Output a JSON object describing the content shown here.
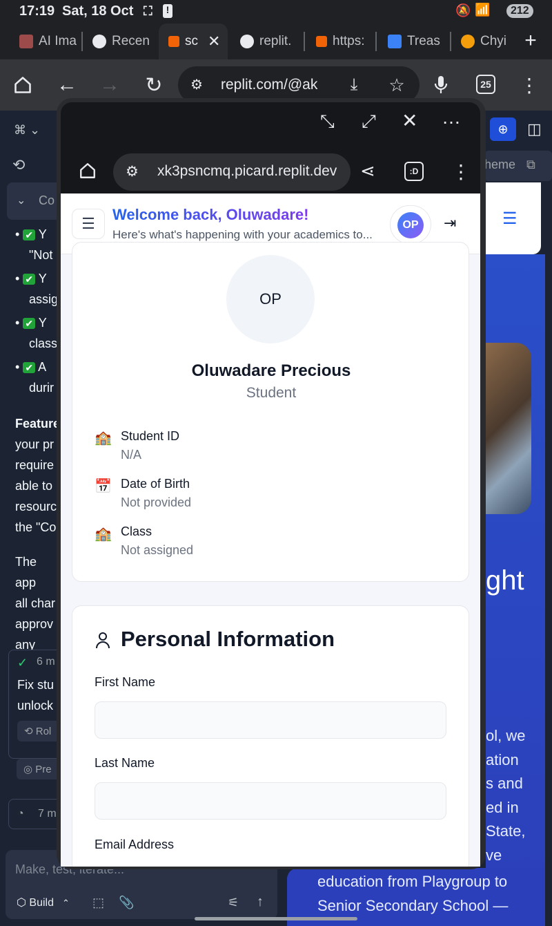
{
  "status": {
    "time": "17:19",
    "date": "Sat, 18 Oct",
    "notifications": "212"
  },
  "tabs": [
    {
      "label": "AI Ima",
      "favicon_color": "#9c4a4a"
    },
    {
      "label": "Recen",
      "favicon_color": "#e8eaed"
    },
    {
      "label": "sc",
      "favicon_color": "#f26207",
      "active": true
    },
    {
      "label": "replit.",
      "favicon_color": "#e8eaed"
    },
    {
      "label": "https:",
      "favicon_color": "#f26207"
    },
    {
      "label": "Treas",
      "favicon_color": "#3b82f6"
    },
    {
      "label": "Chyi",
      "favicon_color": "#f59e0b"
    }
  ],
  "toolbar": {
    "url": "replit.com/@ak",
    "tab_count": "25"
  },
  "background_left": {
    "section": "Co",
    "bullets": [
      "Y",
      "\"Not",
      "Y",
      "assig",
      "Y",
      "class",
      "A",
      "durir"
    ],
    "para1": [
      "Feature",
      "your pr",
      "require",
      "able to",
      "resourc",
      "the \"Co"
    ],
    "para2": [
      "The app",
      "all char",
      "approv",
      "any issu"
    ],
    "checkpoint": "6 m",
    "fix_text": [
      "Fix stu",
      "unlock"
    ],
    "buttons": [
      "Rol",
      "Pre"
    ],
    "item2": "7 m",
    "chat_placeholder": "Make, test, iterate...",
    "build": "Build"
  },
  "background_right": {
    "theme": "heme",
    "heading_frag": "ght",
    "para": [
      "ol, we",
      "ation",
      "s and",
      "ed in",
      "State,",
      "ve"
    ],
    "bottom": [
      "education from Playgroup to",
      "Senior Secondary School —"
    ]
  },
  "popup": {
    "url": "xk3psncmq.picard.replit.dev"
  },
  "app": {
    "welcome": "Welcome back, Oluwadare!",
    "subtitle": "Here's what's happening with your academics to...",
    "avatar_initials": "OP",
    "profile": {
      "initials": "OP",
      "name": "Oluwadare Precious",
      "role": "Student",
      "fields": [
        {
          "label": "Student ID",
          "value": "N/A"
        },
        {
          "label": "Date of Birth",
          "value": "Not provided"
        },
        {
          "label": "Class",
          "value": "Not assigned"
        }
      ]
    },
    "personal": {
      "title": "Personal Information",
      "first_name_label": "First Name",
      "last_name_label": "Last Name",
      "email_label": "Email Address"
    }
  }
}
